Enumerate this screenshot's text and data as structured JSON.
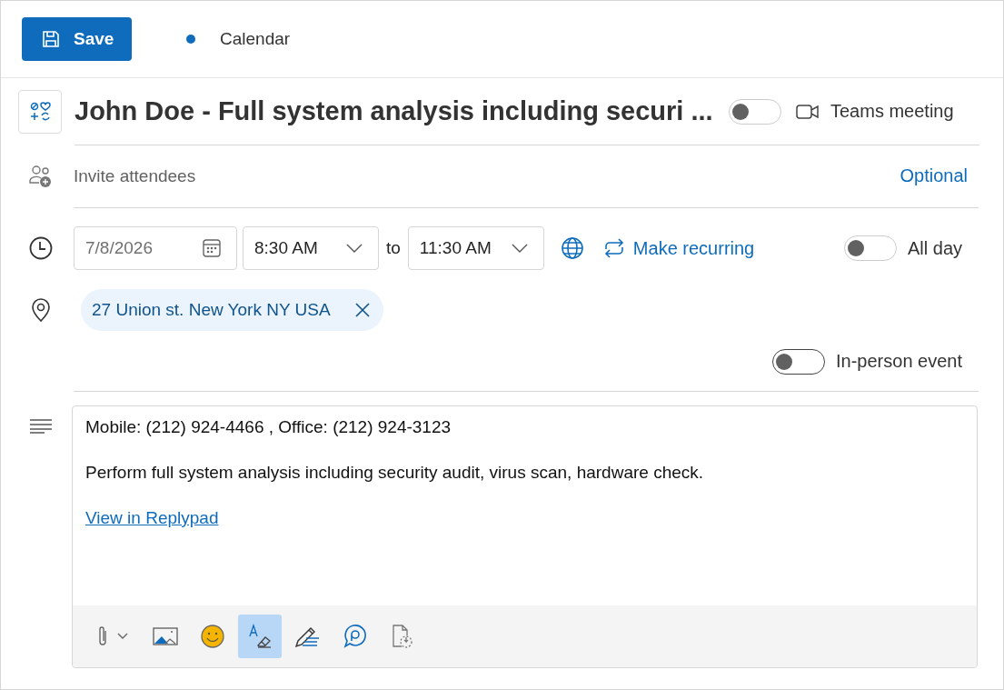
{
  "toolbar": {
    "save_label": "Save",
    "calendar_label": "Calendar"
  },
  "title": "John Doe - Full system analysis including securi ...",
  "teams_meeting": {
    "label": "Teams meeting",
    "on": false
  },
  "attendees": {
    "placeholder": "Invite attendees",
    "optional": "Optional"
  },
  "when": {
    "date": "7/8/2026",
    "start": "8:30 AM",
    "to": "to",
    "end": "11:30 AM",
    "recurring": "Make recurring"
  },
  "all_day": {
    "label": "All day",
    "on": false
  },
  "location": "27 Union st. New York NY USA",
  "in_person": {
    "label": "In-person event",
    "on": false
  },
  "body": [
    {
      "kind": "text",
      "text": "Mobile: (212) 924-4466 , Office: (212) 924-3123"
    },
    {
      "kind": "text",
      "text": "Perform full system analysis including security audit, virus scan, hardware check."
    },
    {
      "kind": "link",
      "text": "View in Replypad"
    }
  ],
  "format_tools": [
    {
      "kind": "attach",
      "selected": false
    },
    {
      "kind": "image",
      "selected": false
    },
    {
      "kind": "emoji",
      "selected": false
    },
    {
      "kind": "eraser",
      "selected": true
    },
    {
      "kind": "pen",
      "selected": false
    },
    {
      "kind": "loop",
      "selected": false
    },
    {
      "kind": "file",
      "selected": false
    }
  ]
}
